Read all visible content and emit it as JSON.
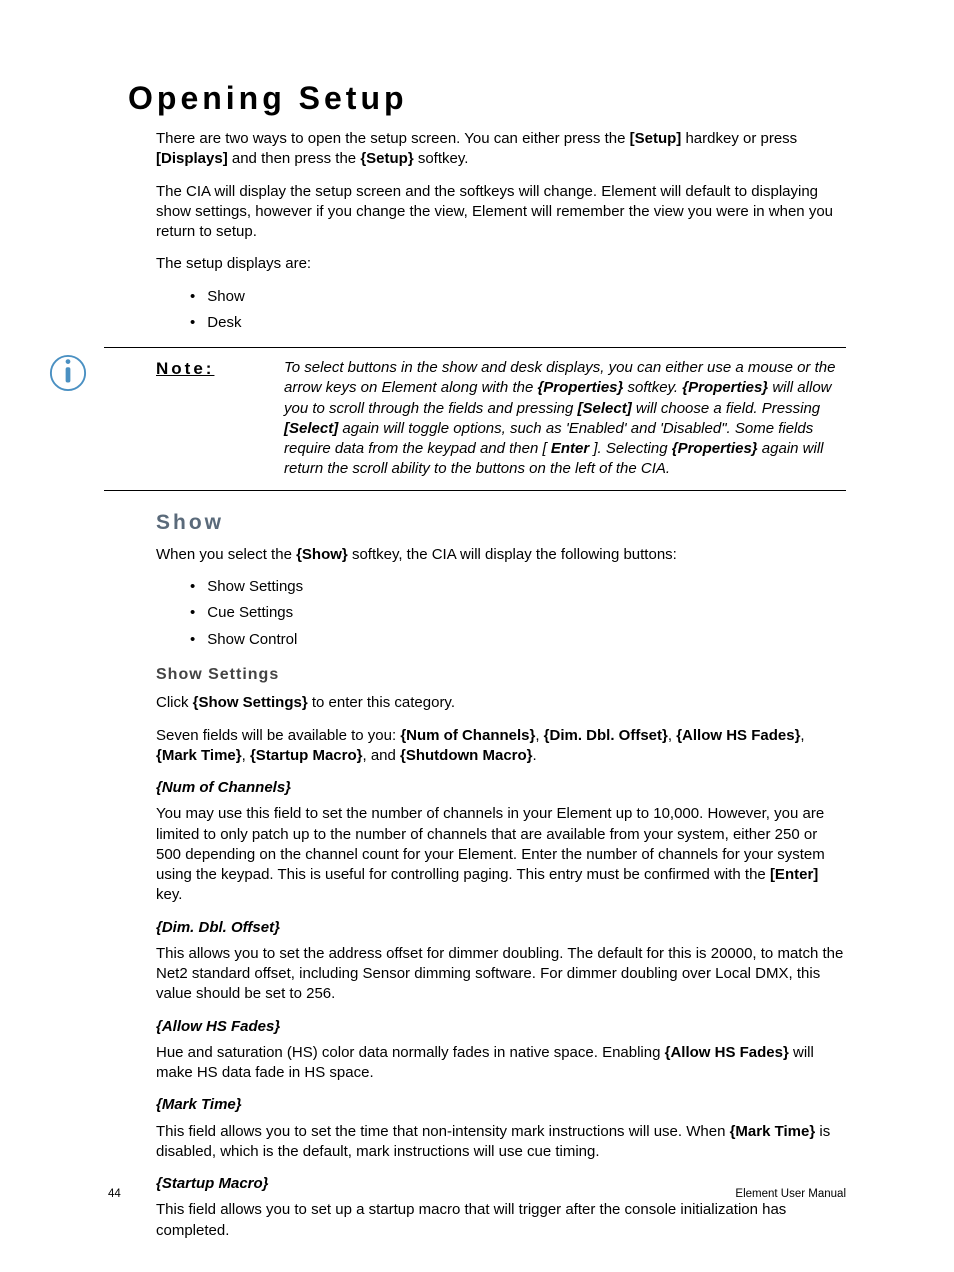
{
  "title": "Opening Setup",
  "p1": {
    "t0": "There are two ways to open the setup screen. You can either press the ",
    "b0": "[Setup]",
    "t1": " hardkey or press ",
    "b1": "[Displays]",
    "t2": " and then press the ",
    "b2": "{Setup}",
    "t3": " softkey."
  },
  "p2": "The CIA will display the setup screen and the softkeys will change. Element will default to displaying show settings, however if you change the view, Element will remember the view you were in when you return to setup.",
  "p3": "The setup displays are:",
  "setup_list": [
    "Show",
    "Desk"
  ],
  "note": {
    "label": "Note:",
    "t0": "To select buttons in the show and desk displays, you can either use a mouse or the arrow keys on Element along with the ",
    "b0": "{Properties}",
    "t1": " softkey. ",
    "b1": "{Properties}",
    "t2": " will allow you to scroll through the fields and pressing ",
    "b2": "[Select]",
    "t3": " will choose a field. Pressing ",
    "b3": "[Select]",
    "t4": " again will toggle options, such as 'Enabled' and 'Disabled\". Some fields require data from the keypad and then [",
    "b4": "Enter",
    "t5": "]. Selecting ",
    "b5": "{Properties}",
    "t6": " again will return the scroll ability to the buttons on the left of the CIA."
  },
  "show": {
    "heading": "Show",
    "intro0": "When you select the ",
    "intro_b": "{Show}",
    "intro1": " softkey, the CIA will display the following buttons:",
    "list": [
      "Show Settings",
      "Cue Settings",
      "Show Control"
    ]
  },
  "show_settings": {
    "heading": "Show Settings",
    "click0": "Click ",
    "click_b": "{Show Settings}",
    "click1": " to enter this category.",
    "seven0": "Seven fields will be available to you: ",
    "f0": "{Num of Channels}",
    "c0": ", ",
    "f1": "{Dim. Dbl. Offset}",
    "c1": ", ",
    "f2": "{Allow HS Fades}",
    "c2": ", ",
    "f3": "{Mark Time}",
    "c3": ", ",
    "f4": "{Startup Macro}",
    "c4": ", and ",
    "f5": "{Shutdown Macro}",
    "c5": "."
  },
  "num": {
    "h": "{Num of Channels}",
    "t0": "You may use this field to set the number of channels in your Element up to 10,000. However, you are limited to only patch up to the number of channels that are available from your system, either 250 or 500 depending on the channel count for your Element. Enter the number of channels for your system using the keypad. This is useful for controlling paging. This entry must be confirmed with the ",
    "b0": "[Enter]",
    "t1": " key."
  },
  "dim": {
    "h": "{Dim. Dbl. Offset}",
    "t": "This allows you to set the address offset for dimmer doubling. The default for this is 20000, to match the Net2 standard offset, including Sensor dimming software. For dimmer doubling over Local DMX, this value should be set to 256."
  },
  "hs": {
    "h": "{Allow HS Fades}",
    "t0": "Hue and saturation (HS) color data normally fades in native space. Enabling ",
    "b0": "{Allow HS Fades}",
    "t1": " will make HS data fade in HS space."
  },
  "mark": {
    "h": "{Mark Time}",
    "t0": "This field allows you to set the time that non-intensity mark instructions will use. When ",
    "b0": "{Mark Time}",
    "t1": " is disabled, which is the default, mark instructions will use cue timing."
  },
  "startup": {
    "h": "{Startup Macro}",
    "t": "This field allows you to set up a startup macro that will trigger after the console initialization has completed."
  },
  "footer": {
    "page": "44",
    "manual": "Element User Manual"
  }
}
